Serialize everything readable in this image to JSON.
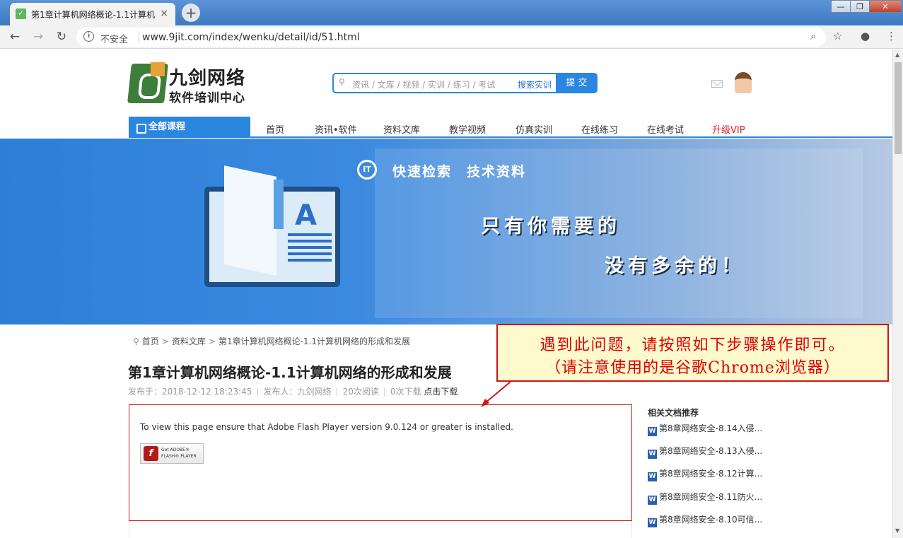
{
  "browser": {
    "tab_title": "第1章计算机网络概论-1.1计算机",
    "tab_close": "×",
    "new_tab": "+",
    "win_min": "—",
    "win_max": "❐",
    "win_close": "✕",
    "back": "←",
    "forward": "→",
    "reload": "↻",
    "security_label": "不安全",
    "url": "www.9jit.com/index/wenku/detail/id/51.html",
    "zoom_icon": "⌕",
    "star_icon": "☆",
    "profile_icon": "●",
    "menu_icon": "⋮"
  },
  "header": {
    "logo_name": "九剑网络",
    "logo_sub": "软件培训中心",
    "search_placeholder": "资讯 / 文库 / 视频 / 实训 / 练习 / 考试",
    "search_link": "搜索实训",
    "search_button": "提 交"
  },
  "nav": {
    "all_courses": "全部课程",
    "items": [
      {
        "label": "首页"
      },
      {
        "label": "资讯•软件"
      },
      {
        "label": "资料文库"
      },
      {
        "label": "教学视频"
      },
      {
        "label": "仿真实训"
      },
      {
        "label": "在线练习"
      },
      {
        "label": "在线考试"
      },
      {
        "label": "升级VIP"
      }
    ],
    "vip_color": "#e02020"
  },
  "banner": {
    "it_badge": "IT",
    "top_text": "快速检索　技术资料",
    "line1": "只有你需要的",
    "line2": "没有多余的！",
    "book_letter": "A"
  },
  "breadcrumb": {
    "items": [
      "首页",
      "资料文库",
      "第1章计算机网络概论-1.1计算机网络的形成和发展"
    ],
    "sep": ">"
  },
  "article": {
    "title": "第1章计算机网络概论-1.1计算机网络的形成和发展",
    "published": "发布于：2018-12-12 18:23:45",
    "publisher": "发布人：九剑网络",
    "reads": "20次阅读",
    "downloads": "0次下载",
    "download_link": "点击下载"
  },
  "flash": {
    "message": "To view this page ensure that Adobe Flash Player version 9.0.124 or greater is installed.",
    "btn_line1": "Get ADOBE®",
    "btn_line2": "FLASH® PLAYER",
    "logo_glyph": "f"
  },
  "callout": {
    "line1": "遇到此问题，请按照如下步骤操作即可。",
    "line2": "（请注意使用的是谷歌Chrome浏览器）"
  },
  "sidebar": {
    "title": "相关文档推荐",
    "items": [
      {
        "label": "第8章网络安全-8.14入侵..."
      },
      {
        "label": "第8章网络安全-8.13入侵..."
      },
      {
        "label": "第8章网络安全-8.12计算..."
      },
      {
        "label": "第8章网络安全-8.11防火..."
      },
      {
        "label": "第8章网络安全-8.10可信..."
      }
    ],
    "doc_icon": "W"
  },
  "colors": {
    "accent": "#2b86e0",
    "callout_border": "#d01515",
    "callout_bg": "#fff9ce"
  }
}
